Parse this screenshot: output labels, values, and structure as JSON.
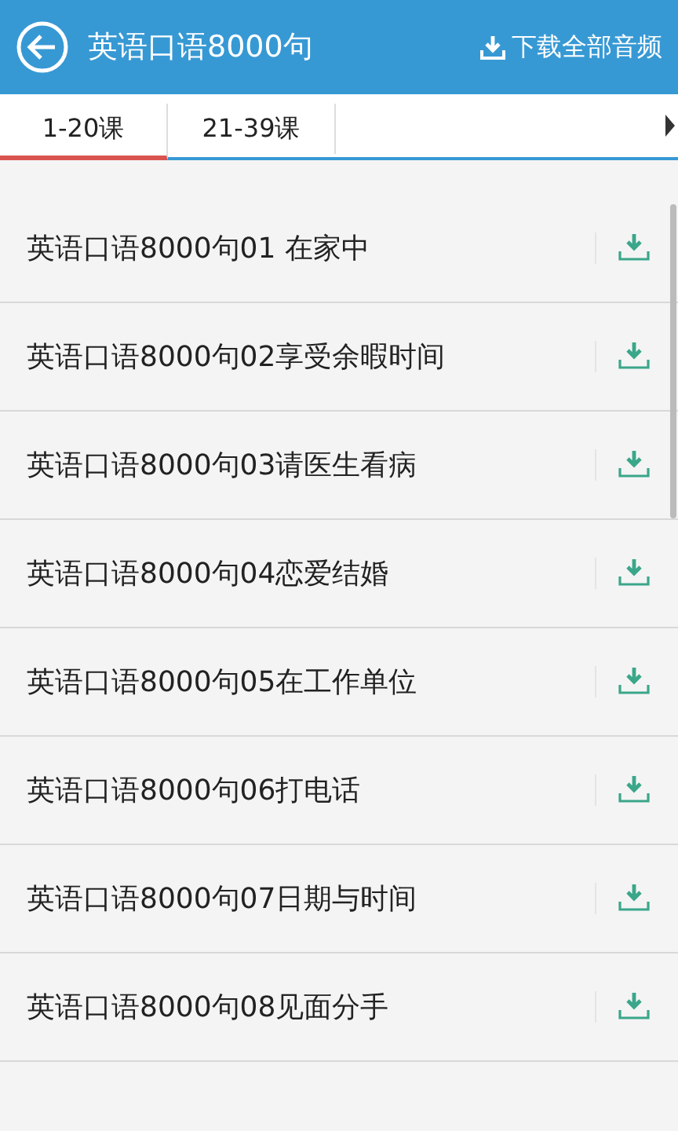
{
  "header": {
    "title": "英语口语8000句",
    "action": "下载全部音频"
  },
  "tabs": [
    {
      "label": "1-20课",
      "selected": true
    },
    {
      "label": "21-39课",
      "selected": false
    }
  ],
  "lessons": [
    {
      "title": "英语口语8000句01 在家中"
    },
    {
      "title": "英语口语8000句02享受余暇时间"
    },
    {
      "title": "英语口语8000句03请医生看病"
    },
    {
      "title": "英语口语8000句04恋爱结婚"
    },
    {
      "title": "英语口语8000句05在工作单位"
    },
    {
      "title": "英语口语8000句06打电话"
    },
    {
      "title": "英语口语8000句07日期与时间"
    },
    {
      "title": "英语口语8000句08见面分手"
    }
  ]
}
